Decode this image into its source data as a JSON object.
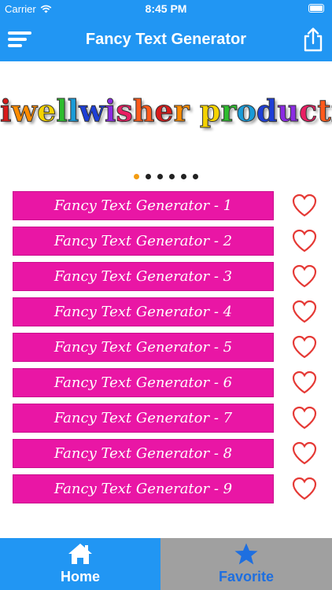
{
  "status_bar": {
    "carrier": "Carrier",
    "time": "8:45 PM"
  },
  "nav": {
    "title": "Fancy Text Generator",
    "menu_icon": "hamburger-menu-icon",
    "share_icon": "share-icon"
  },
  "banner": {
    "text": "iwellwisher production"
  },
  "pager": {
    "count": 6,
    "active_index": 0
  },
  "list": {
    "items": [
      {
        "label": "Fancy Text Generator - 1"
      },
      {
        "label": "Fancy Text Generator - 2"
      },
      {
        "label": "Fancy Text Generator - 3"
      },
      {
        "label": "Fancy Text Generator - 4"
      },
      {
        "label": "Fancy Text Generator - 5"
      },
      {
        "label": "Fancy Text Generator - 6"
      },
      {
        "label": "Fancy Text Generator - 7"
      },
      {
        "label": "Fancy Text Generator - 8"
      },
      {
        "label": "Fancy Text Generator - 9"
      }
    ],
    "row_color": "#e916a5",
    "heart_color": "#e53935"
  },
  "tabs": {
    "home": {
      "label": "Home",
      "icon": "home-icon"
    },
    "favorite": {
      "label": "Favorite",
      "icon": "star-icon"
    }
  },
  "colors": {
    "primary": "#2196f3",
    "inactive_tab": "#a0a0a0",
    "accent_text": "#1e6fe0"
  }
}
